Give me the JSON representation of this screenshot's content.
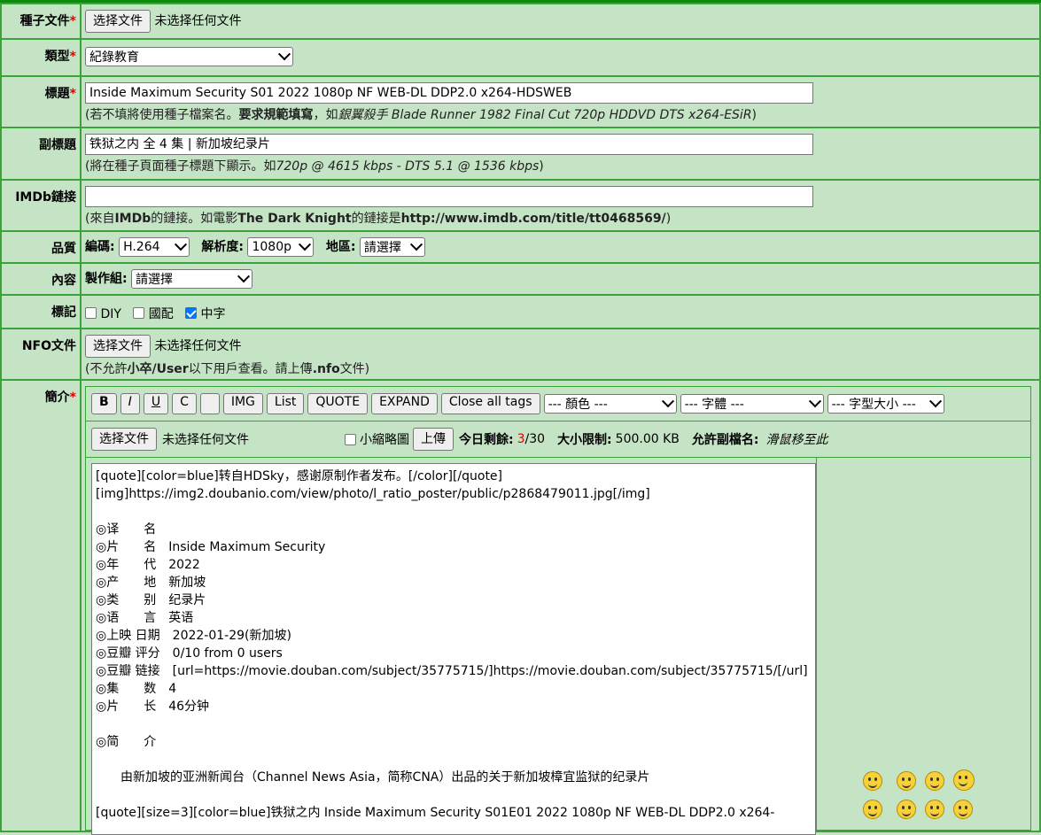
{
  "torrent_file": {
    "label": "種子文件",
    "req": "*",
    "button": "选择文件",
    "status": "未选择任何文件"
  },
  "type": {
    "label": "類型",
    "req": "*",
    "value": "紀錄教育"
  },
  "title": {
    "label": "標題",
    "req": "*",
    "value": "Inside Maximum Security S01 2022 1080p NF WEB-DL DDP2.0 x264-HDSWEB",
    "hint_a": "(若不填將使用種子檔案名。",
    "hint_b": "要求規範填寫",
    "hint_c": "，如",
    "hint_d": "銀翼殺手 Blade Runner 1982 Final Cut 720p HDDVD DTS x264-ESiR",
    "hint_e": ")"
  },
  "subtitle": {
    "label": "副標題",
    "value": "铁狱之内 全 4 集 | 新加坡纪录片",
    "hint_a": "(將在種子頁面種子標題下顯示。如",
    "hint_b": "720p @ 4615 kbps - DTS 5.1 @ 1536 kbps",
    "hint_c": ")"
  },
  "imdb": {
    "label": "IMDb鏈接",
    "value": "",
    "hint_a": "(來自",
    "hint_b": "IMDb",
    "hint_c": "的鏈接。如電影",
    "hint_d": "The Dark Knight",
    "hint_e": "的鏈接是",
    "hint_f": "http://www.imdb.com/title/tt0468569/",
    "hint_g": ")"
  },
  "quality": {
    "label": "品質",
    "codec_label": "編碼:",
    "codec": "H.264",
    "res_label": "解析度:",
    "res": "1080p",
    "region_label": "地區:",
    "region": "請選擇"
  },
  "content": {
    "label": "內容",
    "group_label": "製作組:",
    "group": "請選擇"
  },
  "tags": {
    "label": "標記",
    "diy": "DIY",
    "dub": "國配",
    "zh": "中字"
  },
  "nfo": {
    "label": "NFO文件",
    "button": "选择文件",
    "status": "未选择任何文件",
    "hint_a": "(不允許",
    "hint_b": "小卒/User",
    "hint_c": "以下用戶查看。請上傳",
    "hint_d": ".nfo",
    "hint_e": "文件)"
  },
  "intro": {
    "label": "簡介",
    "req": "*"
  },
  "toolbar": {
    "b": "B",
    "i": "I",
    "u": "U",
    "c": "C",
    "img": "IMG",
    "list": "List",
    "quote": "QUOTE",
    "expand": "EXPAND",
    "close": "Close all tags",
    "color": "--- 顏色 ---",
    "font": "--- 字體 ---",
    "size": "--- 字型大小 ---"
  },
  "upload": {
    "button": "选择文件",
    "status": "未选择任何文件",
    "thumb": "小縮略圖",
    "upload_btn": "上傳",
    "remain_label": "今日剩餘:",
    "remain_used": "3",
    "remain_total": "/30",
    "limit_label": "大小限制:",
    "limit": "500.00 KB",
    "ext_label": "允許副檔名:",
    "ext": "滑鼠移至此"
  },
  "body_text": "[quote][color=blue]转自HDSky，感谢原制作者发布。[/color][/quote]\n[img]https://img2.doubanio.com/view/photo/l_ratio_poster/public/p2868479011.jpg[/img]\n\n◎译　　名\n◎片　　名　Inside Maximum Security\n◎年　　代　2022\n◎产　　地　新加坡\n◎类　　别　纪录片\n◎语　　言　英语\n◎上映 日期　2022-01-29(新加坡)\n◎豆瓣 评分　0/10 from 0 users\n◎豆瓣 链接　[url=https://movie.douban.com/subject/35775715/]https://movie.douban.com/subject/35775715/[/url]\n◎集　　数　4\n◎片　　长　46分钟\n\n◎简　　介\n\n　　由新加坡的亚洲新闻台（Channel News Asia，简称CNA）出品的关于新加坡樟宜监狱的纪录片\n\n[quote][size=3][color=blue]铁狱之内 Inside Maximum Security S01E01 2022 1080p NF WEB-DL DDP2.0 x264-"
}
